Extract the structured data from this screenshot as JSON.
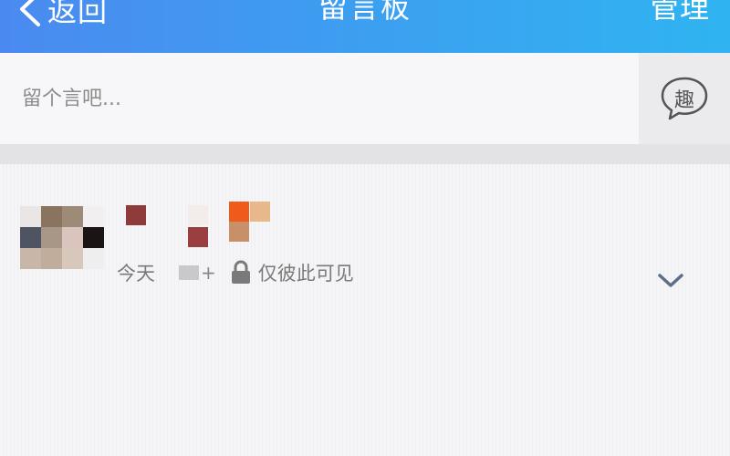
{
  "header": {
    "back_label": "返回",
    "title": "留言板",
    "manage_label": "管理"
  },
  "compose": {
    "placeholder": "留个言吧...",
    "fun_button_label": "趣"
  },
  "messages": [
    {
      "time": "今天",
      "separator": "+",
      "visibility": "仅彼此可见",
      "avatar": "pixelated-avatar",
      "name": "pixelated-name"
    }
  ],
  "colors": {
    "header_gradient_start": "#4a8af0",
    "header_gradient_end": "#2fb4f1",
    "background": "#f3f2f4",
    "meta_text": "#7a7a7a"
  },
  "icons": {
    "back": "chevron-left-icon",
    "fun": "speech-bubble-icon",
    "lock": "lock-icon",
    "expand": "chevron-down-icon"
  }
}
